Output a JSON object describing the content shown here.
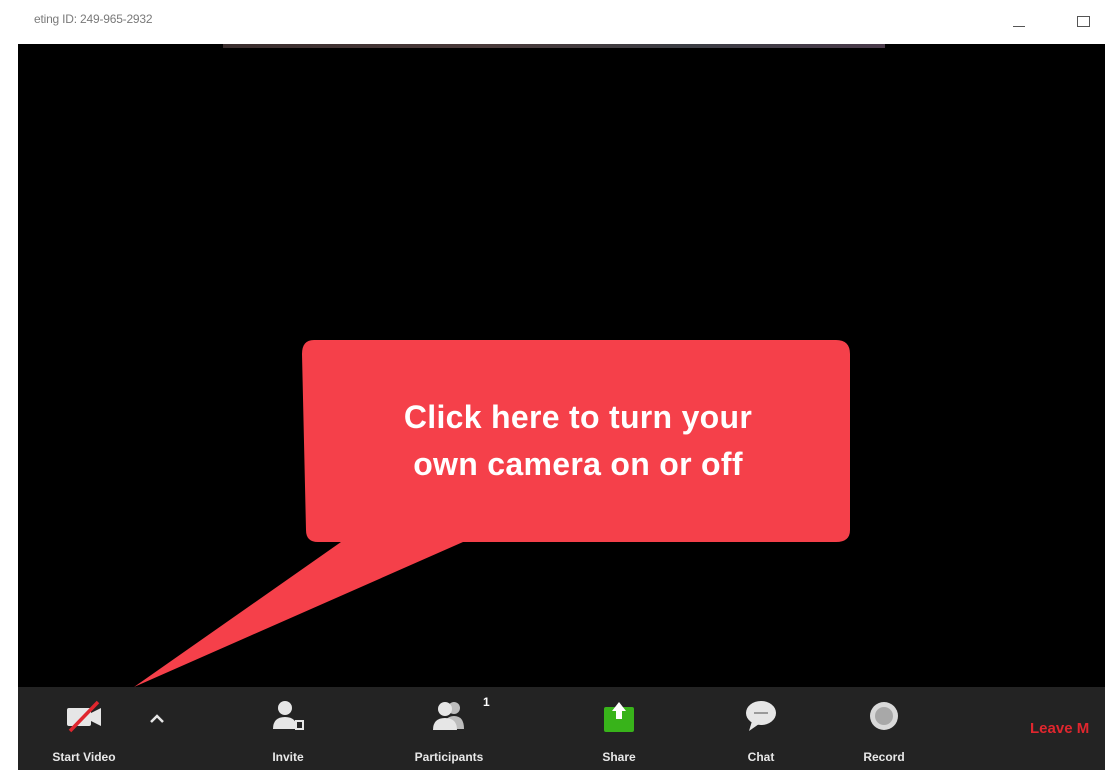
{
  "window": {
    "title": "eting ID: 249-965-2932"
  },
  "callout": {
    "line1": "Click here to turn your",
    "line2": "own camera on or off",
    "color": "#f5404a"
  },
  "toolbar": {
    "start_video_label": "Start Video",
    "invite_label": "Invite",
    "participants_label": "Participants",
    "participants_count": "1",
    "share_label": "Share",
    "chat_label": "Chat",
    "record_label": "Record",
    "leave_label": "Leave M",
    "share_color": "#38b31a",
    "leave_color": "#e0262e"
  },
  "icons": {
    "video": "video-off-icon",
    "caret": "chevron-up-icon",
    "invite": "invite-person-icon",
    "participants": "participants-icon",
    "share": "share-screen-icon",
    "chat": "chat-bubble-icon",
    "record": "record-icon"
  }
}
